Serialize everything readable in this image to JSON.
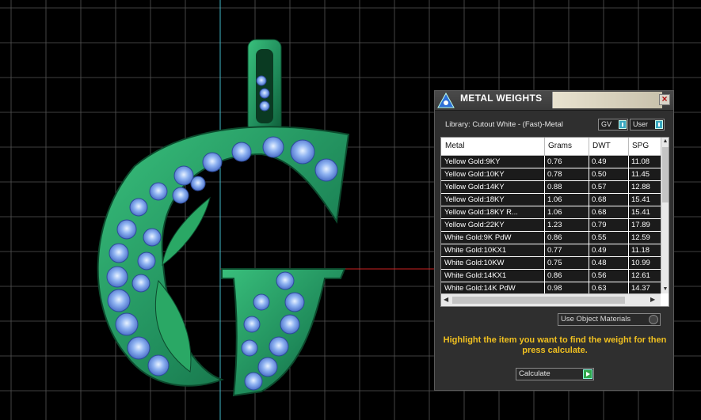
{
  "panel": {
    "title": "METAL WEIGHTS",
    "library_label": "Library: Cutout White - (Fast)-Metal",
    "gv_label": "GV",
    "user_label": "User",
    "close_glyph": "×"
  },
  "table": {
    "headers": [
      "Metal",
      "Grams",
      "DWT",
      "SPG"
    ],
    "rows": [
      [
        "Yellow Gold:9KY",
        "0.76",
        "0.49",
        "11.08"
      ],
      [
        "Yellow Gold:10KY",
        "0.78",
        "0.50",
        "11.45"
      ],
      [
        "Yellow Gold:14KY",
        "0.88",
        "0.57",
        "12.88"
      ],
      [
        "Yellow Gold:18KY",
        "1.06",
        "0.68",
        "15.41"
      ],
      [
        "Yellow Gold:18KY R...",
        "1.06",
        "0.68",
        "15.41"
      ],
      [
        "Yellow Gold:22KY",
        "1.23",
        "0.79",
        "17.89"
      ],
      [
        "White Gold:9K PdW",
        "0.86",
        "0.55",
        "12.59"
      ],
      [
        "White Gold:10KX1",
        "0.77",
        "0.49",
        "11.18"
      ],
      [
        "White Gold:10KW",
        "0.75",
        "0.48",
        "10.99"
      ],
      [
        "White Gold:14KX1",
        "0.86",
        "0.56",
        "12.61"
      ],
      [
        "White Gold:14K PdW",
        "0.98",
        "0.63",
        "14.37"
      ]
    ]
  },
  "dropdown": {
    "value": "Use Object Materials"
  },
  "hint": {
    "text": "Highlight the item you want to find the weight for then press calculate."
  },
  "calculate": {
    "label": "Calculate"
  },
  "colors": {
    "grid": "#555555",
    "metal": "#1f8a5a",
    "gem": "#7fa6f0",
    "axis_red": "#cc2222",
    "axis_cyan": "#3fb8c8",
    "hint": "#f0c020"
  }
}
